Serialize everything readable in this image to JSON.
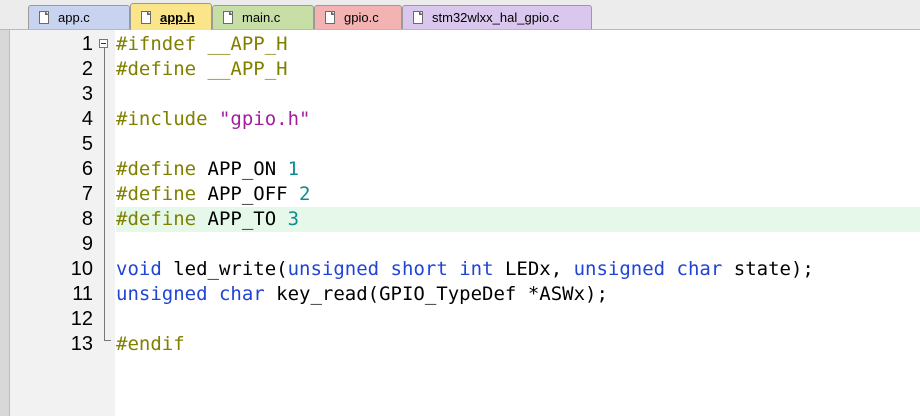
{
  "tabs": [
    {
      "label": "app.c",
      "color": "#c7d3ef",
      "width": 102,
      "active": false
    },
    {
      "label": "app.h",
      "color": "#fbe58a",
      "width": 82,
      "active": true
    },
    {
      "label": "main.c",
      "color": "#c7dfa6",
      "width": 102,
      "active": false
    },
    {
      "label": "gpio.c",
      "color": "#f3b3b3",
      "width": 88,
      "active": false
    },
    {
      "label": "stm32wlxx_hal_gpio.c",
      "color": "#d9c7ee",
      "width": 190,
      "active": false
    }
  ],
  "highlight_line": 8,
  "lines": [
    {
      "num": "1",
      "tokens": [
        [
          "pp",
          "#ifndef __APP_H"
        ]
      ]
    },
    {
      "num": "2",
      "tokens": [
        [
          "pp",
          "#define __APP_H"
        ]
      ]
    },
    {
      "num": "3",
      "tokens": []
    },
    {
      "num": "4",
      "tokens": [
        [
          "pp",
          "#include "
        ],
        [
          "str",
          "\"gpio.h\""
        ]
      ]
    },
    {
      "num": "5",
      "tokens": []
    },
    {
      "num": "6",
      "tokens": [
        [
          "pp",
          "#define "
        ],
        [
          "id",
          "APP_ON "
        ],
        [
          "num",
          "1"
        ]
      ]
    },
    {
      "num": "7",
      "tokens": [
        [
          "pp",
          "#define "
        ],
        [
          "id",
          "APP_OFF "
        ],
        [
          "num",
          "2"
        ]
      ]
    },
    {
      "num": "8",
      "tokens": [
        [
          "pp",
          "#define "
        ],
        [
          "id",
          "APP_TO "
        ],
        [
          "num",
          "3"
        ]
      ]
    },
    {
      "num": "9",
      "tokens": []
    },
    {
      "num": "10",
      "tokens": [
        [
          "kw",
          "void"
        ],
        [
          "id",
          " led_write("
        ],
        [
          "kw",
          "unsigned short int"
        ],
        [
          "id",
          " LEDx, "
        ],
        [
          "kw",
          "unsigned char"
        ],
        [
          "id",
          " state);"
        ]
      ]
    },
    {
      "num": "11",
      "tokens": [
        [
          "kw",
          "unsigned char"
        ],
        [
          "id",
          " key_read(GPIO_TypeDef *ASWx);"
        ]
      ]
    },
    {
      "num": "12",
      "tokens": []
    },
    {
      "num": "13",
      "tokens": [
        [
          "pp",
          "#endif"
        ]
      ]
    }
  ]
}
